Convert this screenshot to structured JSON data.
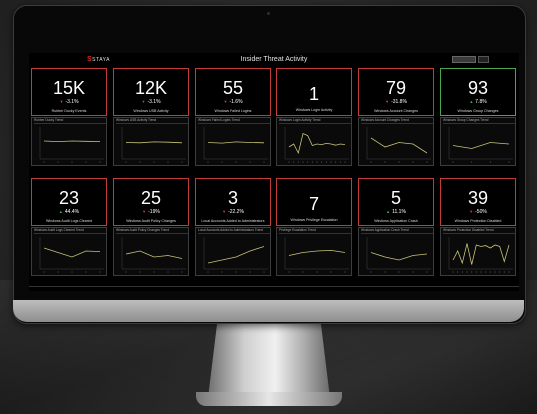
{
  "dashboard": {
    "logo_text": "STAYA",
    "title": "Insider Threat Activity"
  },
  "row1": [
    {
      "value": "15K",
      "change": "-3.1%",
      "dir": "down",
      "label": "Rubber Ducky Events"
    },
    {
      "value": "12K",
      "change": "-3.1%",
      "dir": "down",
      "label": "Windows USB Activity"
    },
    {
      "value": "55",
      "change": "-1.6%",
      "dir": "down",
      "label": "Windows Failed Logins"
    },
    {
      "value": "1",
      "change": "",
      "dir": "none",
      "label": "Windows Login Activity"
    },
    {
      "value": "79",
      "change": "-31.8%",
      "dir": "down",
      "label": "Windows Account Changes"
    },
    {
      "value": "93",
      "change": "7.8%",
      "dir": "up",
      "label": "Windows Group Changes"
    }
  ],
  "row2": [
    {
      "value": "23",
      "change": "44.4%",
      "dir": "up",
      "label": "Windows Audit Logs Cleared"
    },
    {
      "value": "25",
      "change": "-19%",
      "dir": "down",
      "label": "Windows Audit Policy Changes"
    },
    {
      "value": "3",
      "change": "-22.2%",
      "dir": "down",
      "label": "Local Accounts Added to Administrators"
    },
    {
      "value": "7",
      "change": "",
      "dir": "none",
      "label": "Windows Privilege Escalation"
    },
    {
      "value": "5",
      "change": "11.1%",
      "dir": "up",
      "label": "Windows Application Crash"
    },
    {
      "value": "39",
      "change": "-50%",
      "dir": "down",
      "label": "Windows Protection Disabled"
    }
  ],
  "charts_row1": [
    {
      "title": "Rubber Ducky Trend",
      "values": [
        60,
        58,
        60,
        59,
        58
      ]
    },
    {
      "title": "Windows USB Activity Trend",
      "values": [
        55,
        54,
        57,
        56,
        54
      ]
    },
    {
      "title": "Windows Failed Logins Trend",
      "values": [
        55,
        53,
        57,
        55,
        54
      ]
    },
    {
      "title": "Windows Login Activity Trend",
      "values": [
        40,
        50,
        20,
        85,
        78,
        45,
        50,
        48,
        52,
        50,
        46,
        50,
        48
      ]
    },
    {
      "title": "Windows Account Changes Trend",
      "values": [
        70,
        40,
        55,
        50,
        20
      ]
    },
    {
      "title": "Windows Group Changes Trend",
      "values": [
        45,
        35,
        55,
        50
      ]
    }
  ],
  "charts_row2": [
    {
      "title": "Windows Audit Logs Cleared Trend",
      "values": [
        70,
        55,
        40,
        60,
        58
      ]
    },
    {
      "title": "Windows Audit Policy Changes Trend",
      "values": [
        50,
        60,
        40,
        45,
        35
      ]
    },
    {
      "title": "Local Accounts Added to Administrators Trend",
      "values": [
        20,
        30,
        40,
        60,
        75
      ]
    },
    {
      "title": "Privilege Escalation Trend",
      "values": [
        45,
        55,
        60,
        62,
        55
      ]
    },
    {
      "title": "Windows Application Crash Trend",
      "values": [
        55,
        40,
        30,
        45,
        50
      ]
    },
    {
      "title": "Windows Protection Disabled Trend",
      "values": [
        30,
        60,
        20,
        85,
        15,
        80,
        75,
        78,
        70,
        80,
        75,
        25,
        80
      ]
    }
  ],
  "colors": {
    "alert_border": "#c43b3b",
    "ok_border": "#4aa550",
    "down_arrow": "#e23a3a",
    "up_arrow": "#3fb34f",
    "line": "#c8c27a"
  }
}
